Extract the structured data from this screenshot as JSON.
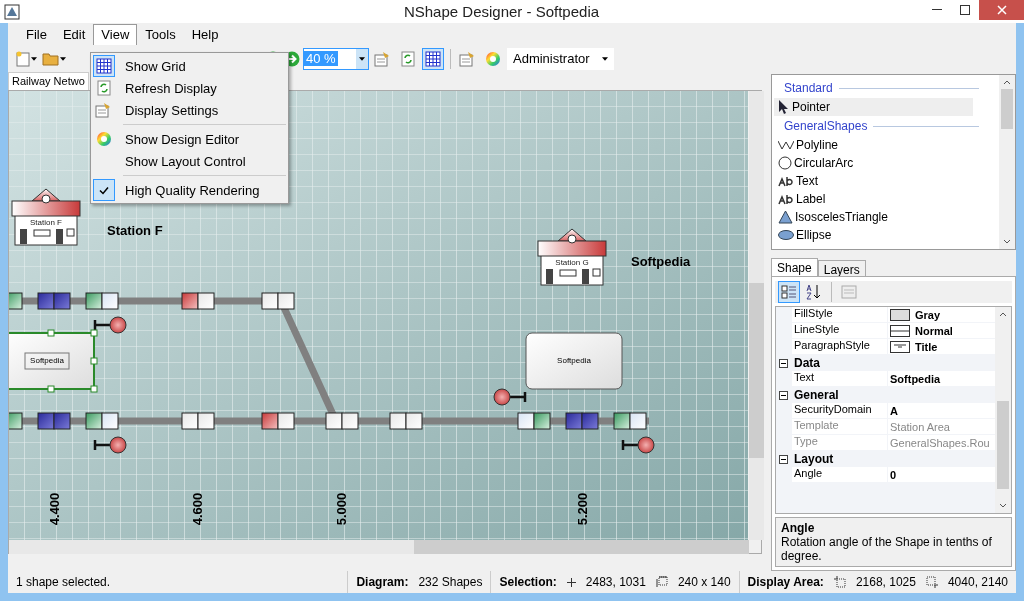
{
  "window": {
    "title": "NShape Designer - Softpedia"
  },
  "menu_bar": [
    {
      "label": "File",
      "selected": false
    },
    {
      "label": "Edit",
      "selected": false
    },
    {
      "label": "View",
      "selected": true
    },
    {
      "label": "Tools",
      "selected": false
    },
    {
      "label": "Help",
      "selected": false
    }
  ],
  "view_menu": [
    {
      "kind": "item",
      "label": "Show Grid",
      "checked": true
    },
    {
      "kind": "item",
      "label": "Refresh Display",
      "checked": false
    },
    {
      "kind": "item",
      "label": "Display Settings",
      "checked": false
    },
    {
      "kind": "separator"
    },
    {
      "kind": "item",
      "label": "Show Design Editor",
      "checked": false
    },
    {
      "kind": "item",
      "label": "Show Layout Control",
      "checked": false
    },
    {
      "kind": "separator"
    },
    {
      "kind": "item",
      "label": "High Quality Rendering",
      "checked": true
    }
  ],
  "toolbar": {
    "zoom": "40 %",
    "grid_button": {
      "selected": true
    },
    "user": "Administrator"
  },
  "document_tab": {
    "label": "Railway Netwo"
  },
  "diagram": {
    "stations": [
      "Station F",
      "Station G"
    ],
    "labels": [
      "Station F",
      "Softpedia"
    ],
    "boxes": [
      {
        "text": "Softpedia",
        "selected": true
      },
      {
        "text": "Softpedia",
        "selected": false
      }
    ],
    "km_marks": [
      "4.400",
      "4.600",
      "5.000",
      "5.200"
    ]
  },
  "toolbox": [
    {
      "name": "Standard",
      "items": [
        {
          "label": "Pointer",
          "selected": true
        }
      ]
    },
    {
      "name": "GeneralShapes",
      "items": [
        {
          "label": "Polyline",
          "selected": false
        },
        {
          "label": "CircularArc",
          "selected": false
        },
        {
          "label": "Text",
          "selected": false
        },
        {
          "label": "Label",
          "selected": false
        },
        {
          "label": "IsoscelesTriangle",
          "selected": false
        },
        {
          "label": "Ellipse",
          "selected": false
        }
      ]
    }
  ],
  "property_tabs": [
    {
      "label": "Shape",
      "selected": true
    },
    {
      "label": "Layers",
      "selected": false
    }
  ],
  "property_view": {
    "categorized": true
  },
  "properties": [
    {
      "kind": "row",
      "name": "FillStyle",
      "value": "Gray",
      "disabled": false
    },
    {
      "kind": "row",
      "name": "LineStyle",
      "value": "Normal",
      "disabled": false
    },
    {
      "kind": "row",
      "name": "ParagraphStyle",
      "value": "Title",
      "disabled": false
    },
    {
      "kind": "category",
      "name": "Data",
      "expanded": true,
      "children": [
        {
          "kind": "row",
          "name": "Text",
          "value": "Softpedia",
          "disabled": false
        }
      ]
    },
    {
      "kind": "category",
      "name": "General",
      "expanded": true,
      "children": [
        {
          "kind": "row",
          "name": "SecurityDomain",
          "value": "A",
          "disabled": false
        },
        {
          "kind": "row",
          "name": "Template",
          "value": "Station Area",
          "disabled": true
        },
        {
          "kind": "row",
          "name": "Type",
          "value": "GeneralShapes.Rou",
          "disabled": true
        }
      ]
    },
    {
      "kind": "category",
      "name": "Layout",
      "expanded": true,
      "children": [
        {
          "kind": "row",
          "name": "Angle",
          "value": "0",
          "disabled": false
        }
      ]
    }
  ],
  "description": {
    "title": "Angle",
    "text": "Rotation angle of the Shape in tenths of degree."
  },
  "status_bar": {
    "message": "1 shape selected.",
    "diagram_label": "Diagram:",
    "diagram_value": "232 Shapes",
    "selection_label": "Selection:",
    "position": "2483, 1031",
    "size": "240 x 140",
    "display_label": "Display Area:",
    "area_origin": "2168, 1025",
    "area_size": "4040, 2140"
  }
}
